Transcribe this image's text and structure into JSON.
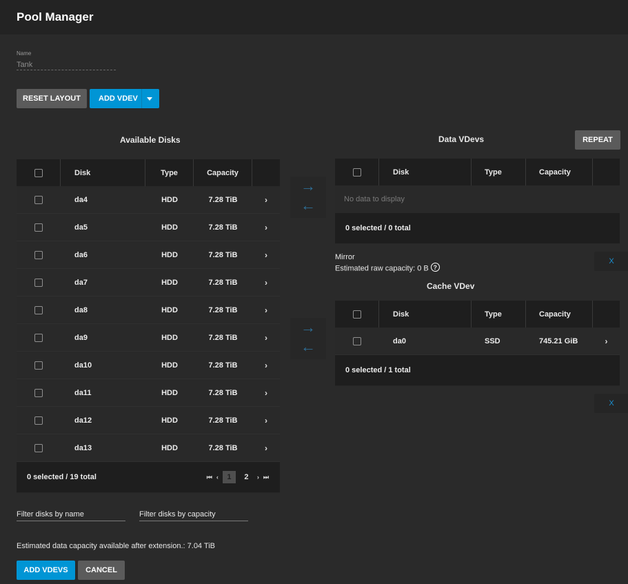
{
  "title": "Pool Manager",
  "name_field": {
    "label": "Name",
    "value": "Tank"
  },
  "buttons": {
    "reset_layout": "RESET LAYOUT",
    "add_vdev": "ADD VDEV",
    "repeat": "REPEAT",
    "add_vdevs": "ADD VDEVS",
    "cancel": "CANCEL",
    "remove_x": "X"
  },
  "available_disks": {
    "title": "Available Disks",
    "columns": [
      "Disk",
      "Type",
      "Capacity"
    ],
    "rows": [
      {
        "disk": "da4",
        "type": "HDD",
        "capacity": "7.28 TiB"
      },
      {
        "disk": "da5",
        "type": "HDD",
        "capacity": "7.28 TiB"
      },
      {
        "disk": "da6",
        "type": "HDD",
        "capacity": "7.28 TiB"
      },
      {
        "disk": "da7",
        "type": "HDD",
        "capacity": "7.28 TiB"
      },
      {
        "disk": "da8",
        "type": "HDD",
        "capacity": "7.28 TiB"
      },
      {
        "disk": "da9",
        "type": "HDD",
        "capacity": "7.28 TiB"
      },
      {
        "disk": "da10",
        "type": "HDD",
        "capacity": "7.28 TiB"
      },
      {
        "disk": "da11",
        "type": "HDD",
        "capacity": "7.28 TiB"
      },
      {
        "disk": "da12",
        "type": "HDD",
        "capacity": "7.28 TiB"
      },
      {
        "disk": "da13",
        "type": "HDD",
        "capacity": "7.28 TiB"
      }
    ],
    "footer": "0 selected / 19 total",
    "pager": {
      "pages": [
        "1",
        "2"
      ],
      "current": "1"
    }
  },
  "data_vdevs": {
    "title": "Data VDevs",
    "columns": [
      "Disk",
      "Type",
      "Capacity"
    ],
    "empty_text": "No data to display",
    "footer": "0 selected / 0 total",
    "layout_label": "Mirror",
    "estimated_raw": "Estimated raw capacity: 0 B"
  },
  "cache_vdev": {
    "title": "Cache VDev",
    "columns": [
      "Disk",
      "Type",
      "Capacity"
    ],
    "rows": [
      {
        "disk": "da0",
        "type": "SSD",
        "capacity": "745.21 GiB"
      }
    ],
    "footer": "0 selected / 1 total"
  },
  "filters": {
    "by_name": "Filter disks by name",
    "by_capacity": "Filter disks by capacity"
  },
  "estimated_after_extension": "Estimated data capacity available after extension.: 7.04 TiB",
  "icons": {
    "move_right": "arrow-right-icon",
    "move_left": "arrow-left-icon",
    "help": "help-circle-icon",
    "row_expand": "chevron-right-icon",
    "dropdown": "caret-down-icon"
  },
  "colors": {
    "accent": "#0095d5",
    "background": "#2a2a2a",
    "header": "#232323",
    "arrow": "#2e6f97"
  }
}
